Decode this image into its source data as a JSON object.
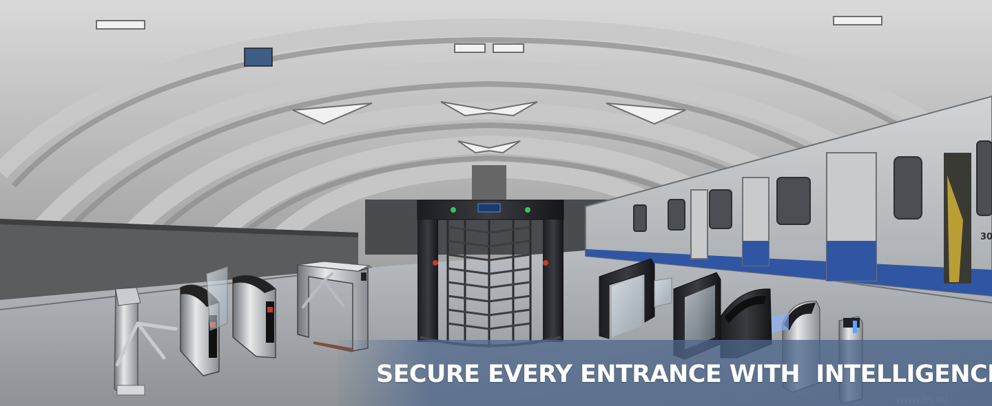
{
  "banner": {
    "headline": "SECURE EVERY ENTRANCE WITH  INTELLIGENCE",
    "accent_color": "#4e6a8e",
    "headline_color": "#ffffff"
  },
  "scene": {
    "setting": "metro station platform",
    "products": [
      "tripod-turnstile",
      "swing-barrier",
      "flap-barrier",
      "tripod-turnstile-frame",
      "full-height-turnstile",
      "swing-gate",
      "flap-barrier",
      "speed-gate",
      "pillar-reader"
    ],
    "train_number": "30",
    "watermark": "WWW.OS.RU"
  }
}
